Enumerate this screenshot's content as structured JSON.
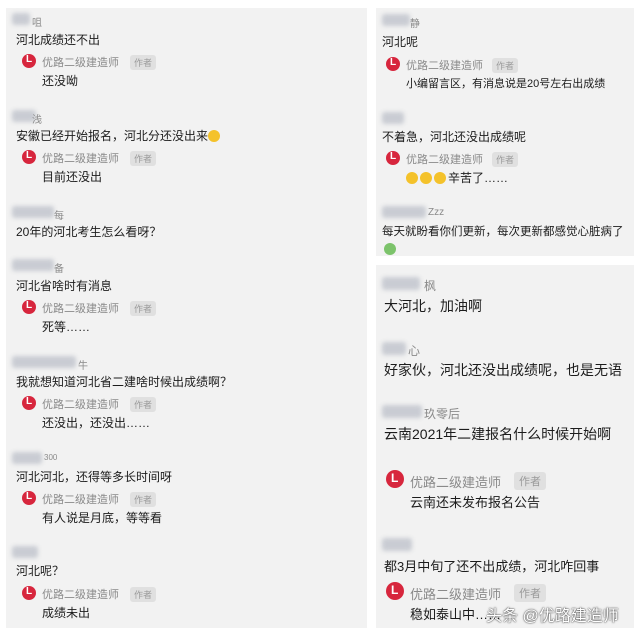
{
  "left_panel": {
    "comments": [
      {
        "user": "咀",
        "question": "河北成绩还不出",
        "author": "优路二级建造师",
        "badge": "作者",
        "reply": "还没呦"
      },
      {
        "user": "浅",
        "question": "安徽已经开始报名，河北分还没出来",
        "author": "优路二级建造师",
        "badge": "作者",
        "reply": "目前还没出"
      },
      {
        "user": "每",
        "question": "20年的河北考生怎么看呀？"
      },
      {
        "user": "备",
        "question": "河北省啥时有消息",
        "author": "优路二级建造师",
        "badge": "作者",
        "reply": "死等……"
      },
      {
        "user": "牛",
        "question": "我就想知道河北省二建啥时候出成绩啊？",
        "author": "优路二级建造师",
        "badge": "作者",
        "reply": "还没出，还没出……"
      },
      {
        "user": "300",
        "question": "河北河北，还得等多长时间呀",
        "author": "优路二级建造师",
        "badge": "作者",
        "reply": "有人说是月底，等等看"
      },
      {
        "user": "",
        "question": "河北呢？",
        "author": "优路二级建造师",
        "badge": "作者",
        "reply": "成绩未出"
      }
    ]
  },
  "right_top_panel": {
    "comments": [
      {
        "user": "静",
        "question": "河北呢",
        "author": "优路二级建造师",
        "badge": "作者",
        "reply": "小编留言区，有消息说是20号左右出成绩"
      },
      {
        "user": "",
        "question": "不着急，河北还没出成绩呢",
        "author": "优路二级建造师",
        "badge": "作者",
        "reply": "辛苦了……"
      },
      {
        "user": "Zzz",
        "question": "每天就盼看你们更新，每次更新都感觉心脏病了"
      }
    ]
  },
  "right_bottom_panel": {
    "comments": [
      {
        "user": "枫",
        "question": "大河北，加油啊"
      },
      {
        "user": "心",
        "question": "好家伙，河北还没出成绩呢，也是无语"
      },
      {
        "user": "玖零后",
        "question": "云南2021年二建报名什么时候开始啊",
        "author": "优路二级建造师",
        "badge": "作者",
        "reply": "云南还未发布报名公告"
      },
      {
        "user": "",
        "question": "都3月中旬了还不出成绩，河北咋回事",
        "author": "优路二级建造师",
        "badge": "作者",
        "reply": "稳如泰山中……"
      }
    ]
  },
  "watermark": "头条 @优路建造师",
  "colors": {
    "panel_bg": "#f2f2f2",
    "logo_red": "#d7263d",
    "muted": "#8a8a8a"
  }
}
